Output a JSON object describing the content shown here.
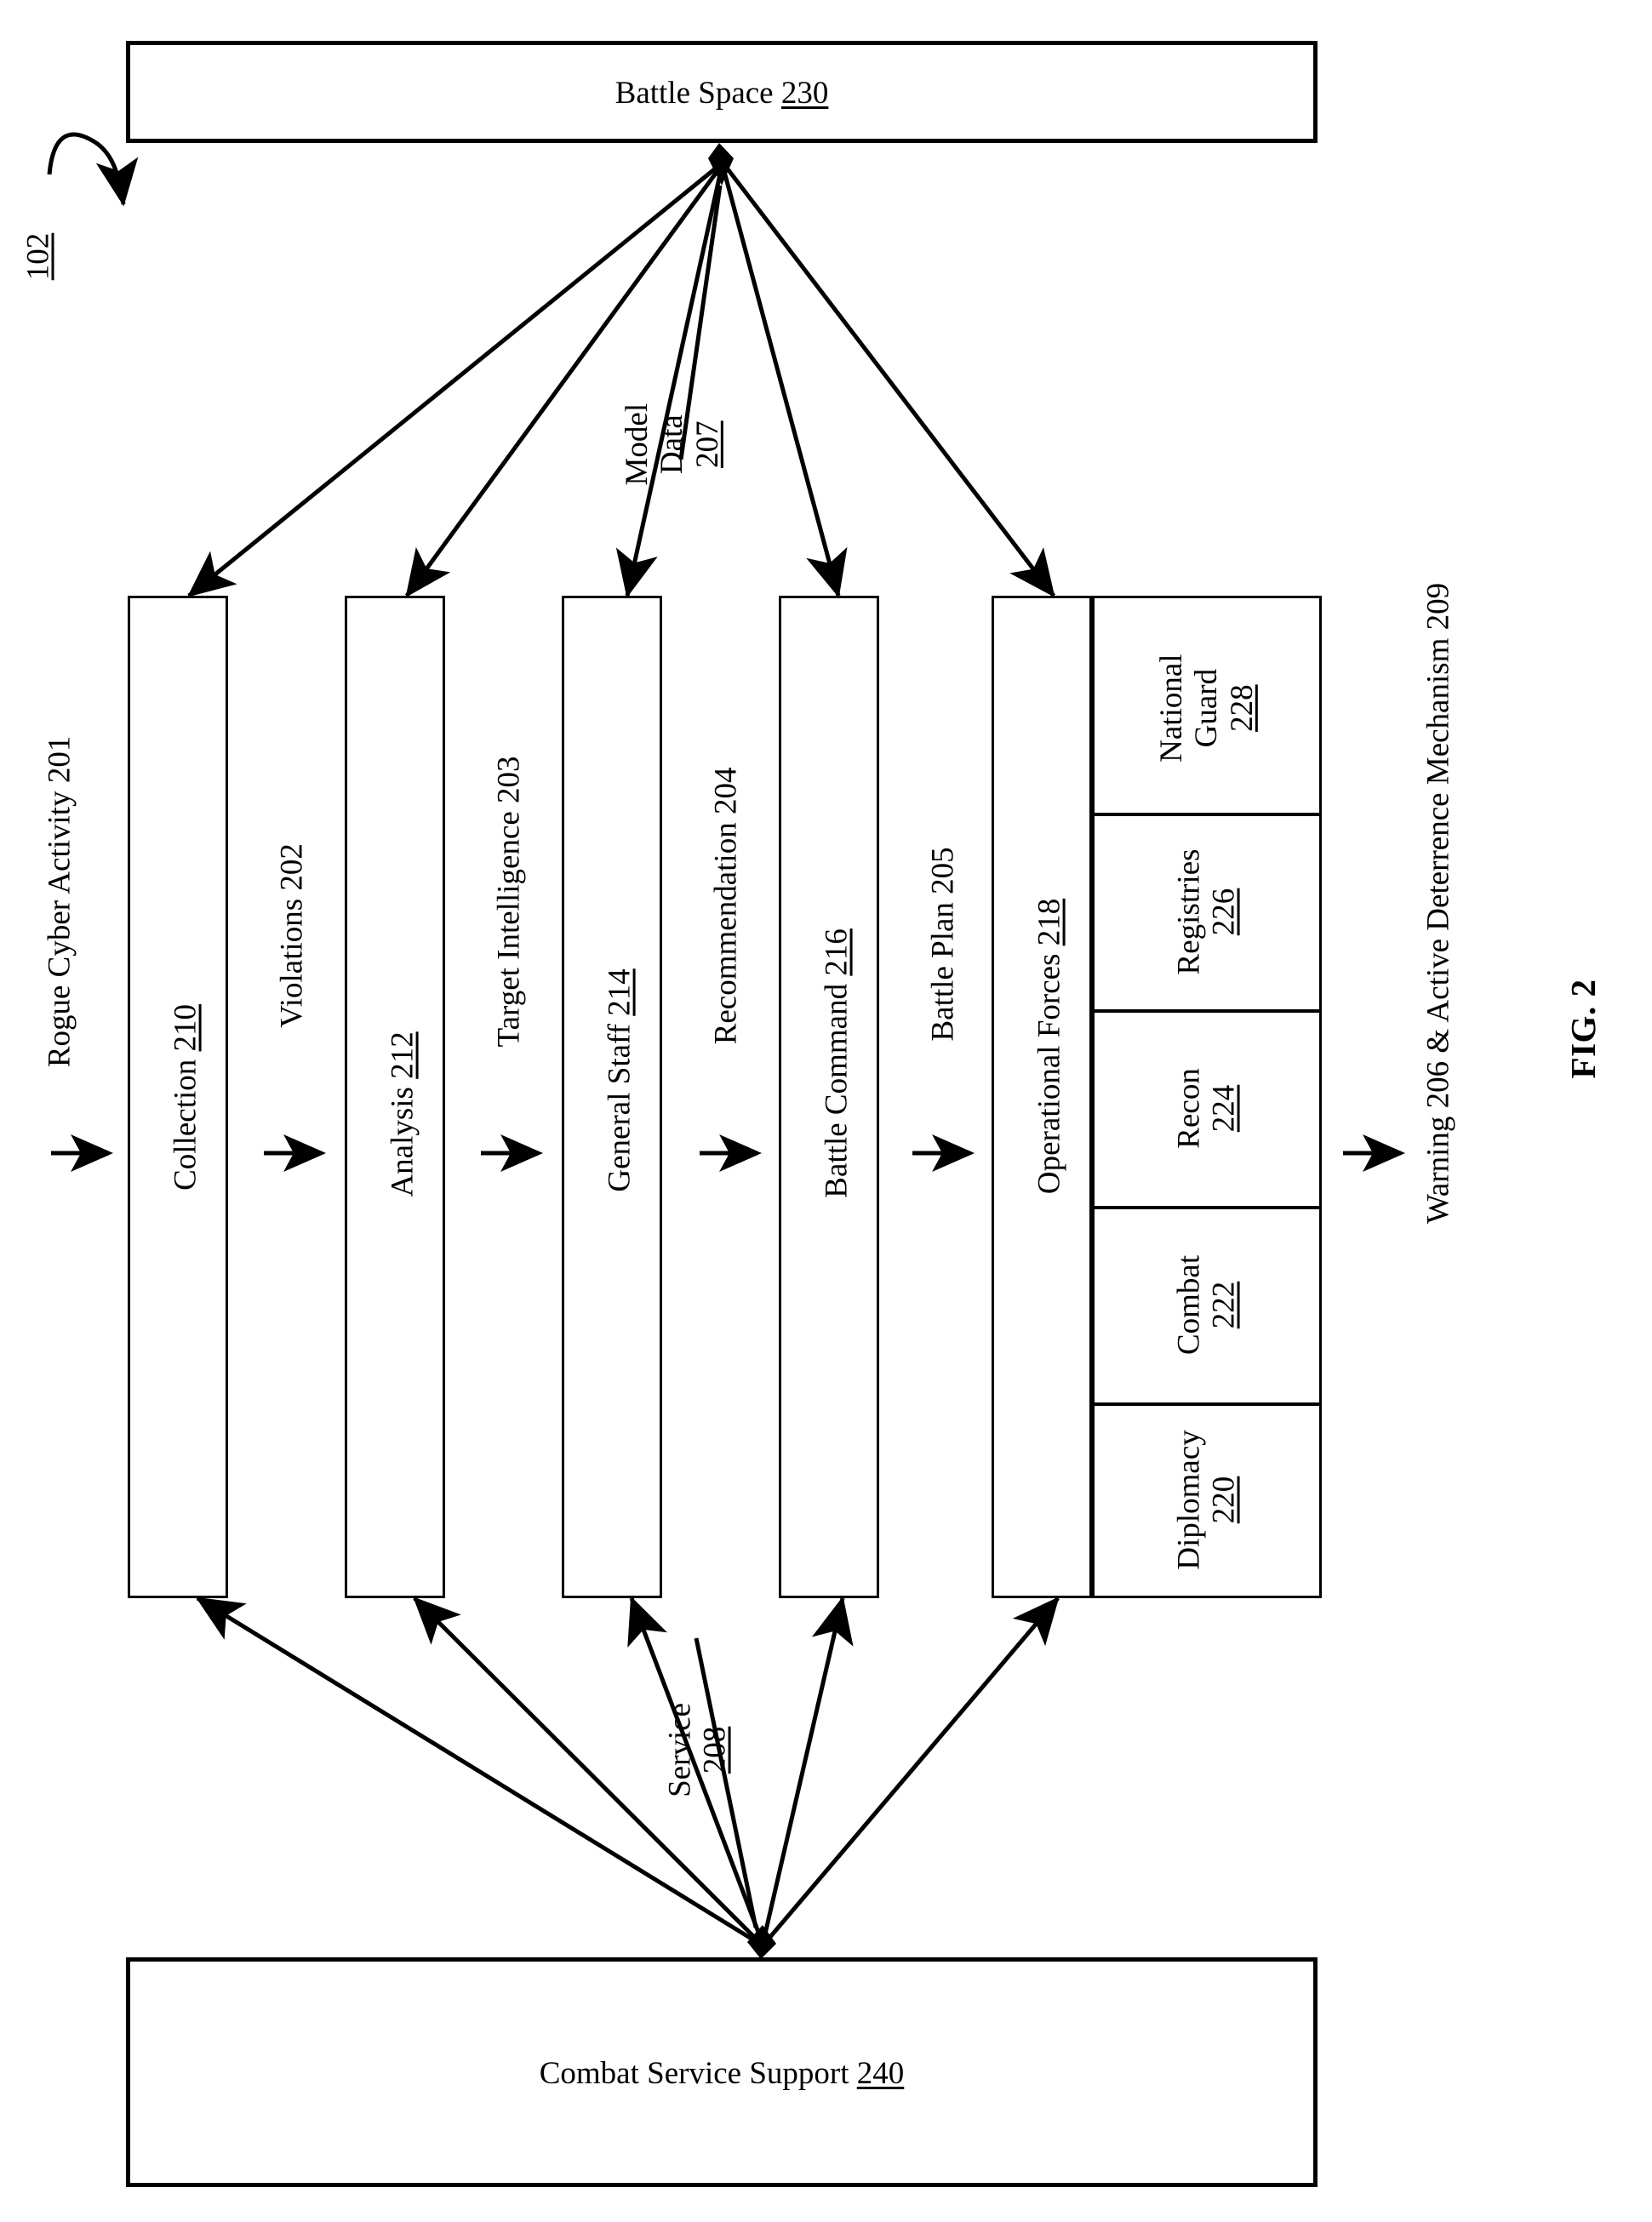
{
  "figure": {
    "label": "FIG. 2",
    "system_ref": "102"
  },
  "top_container": {
    "label": "Battle Space",
    "ref": "230"
  },
  "bottom_container": {
    "label": "Combat Service Support",
    "ref": "240"
  },
  "pipeline": {
    "stages": [
      {
        "label": "Collection",
        "ref": "210"
      },
      {
        "label": "Analysis",
        "ref": "212"
      },
      {
        "label": "General Staff",
        "ref": "214"
      },
      {
        "label": "Battle Command",
        "ref": "216"
      },
      {
        "label": "Operational Forces",
        "ref": "218"
      }
    ]
  },
  "flow_labels": {
    "input": "Rogue Cyber Activity 201",
    "between": [
      "Violations 202",
      "Target Intelligence 203",
      "Recommendation 204",
      "Battle Plan 205"
    ],
    "output": "Warning 206 & Active Deterrence Mechanism 209"
  },
  "data_flows": {
    "model_data": {
      "line1": "Model",
      "line2": "Data",
      "ref": "207"
    },
    "service": {
      "line1": "Service",
      "ref": "208"
    }
  },
  "operational_forces_cells": [
    {
      "line1": "Diplomacy",
      "ref": "220"
    },
    {
      "line1": "Combat",
      "ref": "222"
    },
    {
      "line1": "Recon",
      "ref": "224"
    },
    {
      "line1": "Registries",
      "ref": "226"
    },
    {
      "line1": "National",
      "line2": "Guard",
      "ref": "228"
    }
  ],
  "colors": {
    "stroke": "#000000",
    "background": "#ffffff"
  }
}
